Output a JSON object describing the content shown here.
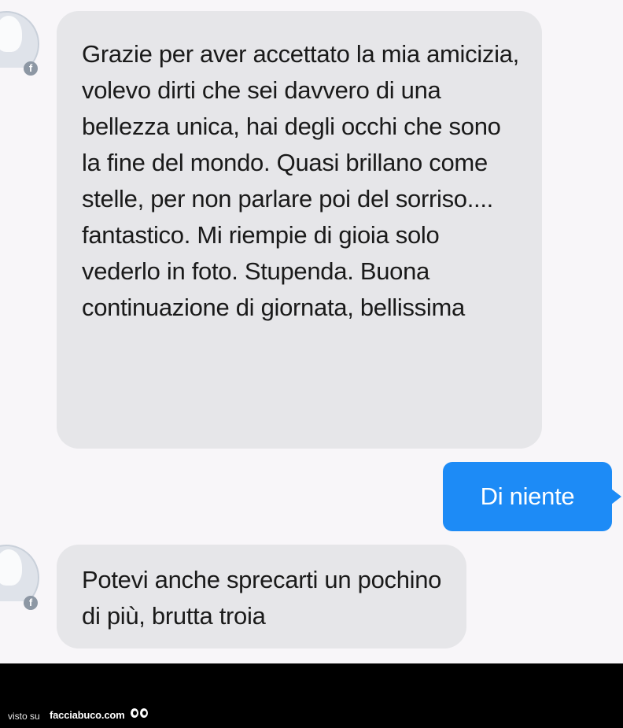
{
  "conversation": {
    "messages": [
      {
        "direction": "incoming",
        "text": "Grazie per aver accettato la mia amicizia, volevo dirti che sei davvero di una bellezza unica, hai degli occhi che sono la fine del mondo. Quasi brillano come stelle, per non parlare poi del sorriso.... fantastico. Mi riempie di gioia solo vederlo in foto. Stupenda. Buona continuazione di giornata, bellissima"
      },
      {
        "direction": "outgoing",
        "text": "Di niente"
      },
      {
        "direction": "incoming",
        "text": "Potevi anche sprecarti un pochino di più, brutta troia"
      }
    ],
    "incoming_bubble_color": "#e6e6e9",
    "outgoing_bubble_color": "#1d8bf6",
    "avatar_badge_icon": "facebook-icon"
  },
  "footer": {
    "prefix": "visto su",
    "brand": "facciabuco.com",
    "logo_icon": "eyes-icon"
  }
}
